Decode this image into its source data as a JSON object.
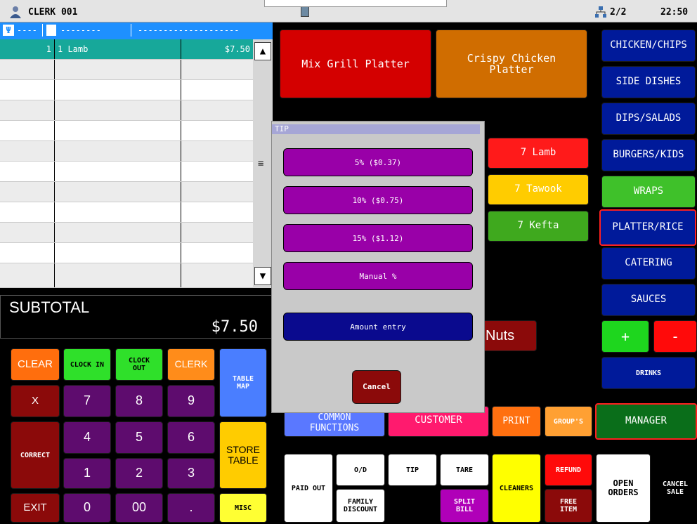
{
  "topbar": {
    "clerk": "CLERK 001",
    "page": "2/2",
    "time": "22:50"
  },
  "listhead": {
    "seg1": "----",
    "seg2": "--------",
    "seg3": "--------------------"
  },
  "order": {
    "qty": "1",
    "item": "1 Lamb",
    "price": "$7.50"
  },
  "subtotal": {
    "label": "SUBTOTAL",
    "amount": "$7.50"
  },
  "keypad": {
    "clear": "CLEAR",
    "clock_in": "CLOCK IN",
    "clock_out": "CLOCK\nOUT",
    "clerk": "CLERK",
    "table_map": "TABLE\nMAP",
    "x": "X",
    "correct": "CORRECT",
    "exit": "EXIT",
    "store_table": "STORE\nTABLE",
    "misc": "MISC",
    "k7": "7",
    "k8": "8",
    "k9": "9",
    "k4": "4",
    "k5": "5",
    "k6": "6",
    "k1": "1",
    "k2": "2",
    "k3": "3",
    "k0": "0",
    "k00": "00",
    "kdot": "."
  },
  "menu": {
    "mix_grill": "Mix Grill Platter",
    "crispy_chicken": "Crispy Chicken\nPlatter",
    "lamb": "7 Lamb",
    "tawook": "7 Tawook",
    "kefta": "7 Kefta",
    "nuts": "Nuts"
  },
  "categories": [
    "CHICKEN/CHIPS",
    "SIDE DISHES",
    "DIPS/SALADS",
    "BURGERS/KIDS",
    "WRAPS",
    "PLATTER/RICE",
    "CATERING",
    "SAUCES"
  ],
  "controls": {
    "plus": "+",
    "minus": "-",
    "drinks": "DRINKS",
    "manager": "MANAGER"
  },
  "functions": {
    "common": "COMMON\nFUNCTIONS",
    "customer": "CUSTOMER",
    "print": "PRINT",
    "groups": "GROUP'S",
    "paid_out": "PAID OUT",
    "od": "O/D",
    "tip": "TIP",
    "tare": "TARE",
    "family_discount": "FAMILY\nDISCOUNT",
    "split_bill": "SPLIT\nBILL",
    "cleaners": "CLEANERS",
    "refund": "REFUND",
    "free_item": "FREE\nITEM",
    "open_orders": "OPEN\nORDERS",
    "cancel_sale": "CANCEL\nSALE"
  },
  "tip_dialog": {
    "title": "TIP",
    "opt5": "5% ($0.37)",
    "opt10": "10% ($0.75)",
    "opt15": "15% ($1.12)",
    "manual": "Manual %",
    "amount": "Amount entry",
    "cancel": "Cancel"
  },
  "colors": {
    "accent": "#1e90ff",
    "selected_row": "#17a89a",
    "dialog_button": "#9900a8",
    "amount_button": "#0a0a8e"
  }
}
